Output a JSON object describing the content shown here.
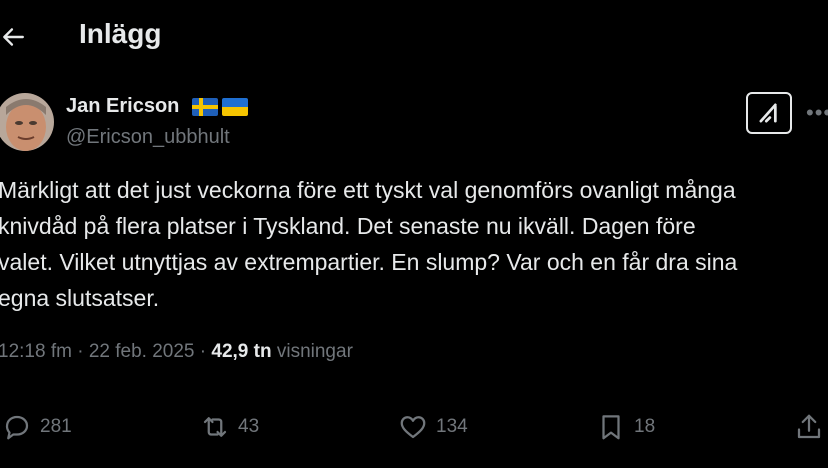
{
  "header": {
    "title": "Inlägg",
    "back_icon": "arrow-left-icon"
  },
  "author": {
    "name": "Jan Ericson",
    "handle": "@Ericson_ubbhult",
    "flags": [
      "sweden-flag",
      "ukraine-flag"
    ]
  },
  "tweet": {
    "text": "Märkligt att det just veckorna före ett tyskt val genomförs ovanligt många\nknivdåd på flera platser i Tyskland. Det senaste nu ikväll. Dagen före\nvalet. Vilket utnyttjas av extrempartier. En slump? Var och en får dra sina\negna slutsatser.",
    "time": "12:18 fm",
    "date": "22 feb. 2025",
    "views_count": "42,9 tn",
    "views_label": "visningar"
  },
  "actions": {
    "replies": "281",
    "reposts": "43",
    "likes": "134",
    "bookmarks": "18"
  },
  "colors": {
    "background": "#000000",
    "text": "#e7e9ea",
    "muted": "#71767b"
  }
}
